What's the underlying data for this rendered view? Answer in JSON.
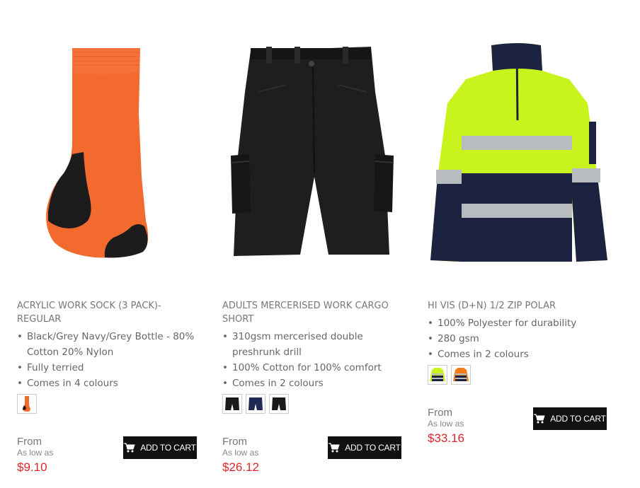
{
  "products": [
    {
      "title": "ACRYLIC WORK SOCK (3 PACK)- REGULAR",
      "features": [
        "Black/Grey Navy/Grey Bottle - 80% Cotton 20% Nylon",
        "Fully terried",
        "Comes in 4 colours"
      ],
      "from_label": "From",
      "as_low_as_label": "As low as",
      "price": "$9.10",
      "cart_label": "ADD TO CART",
      "image_icon": "sock-icon",
      "swatch_colors": [
        "#f26a2e"
      ]
    },
    {
      "title": "ADULTS MERCERISED WORK CARGO SHORT",
      "features": [
        "310gsm mercerised double preshrunk drill",
        "100% Cotton for 100% comfort",
        "Comes in 2 colours"
      ],
      "from_label": "From",
      "as_low_as_label": "As low as",
      "price": "$26.12",
      "cart_label": "ADD TO CART",
      "image_icon": "cargo-shorts-icon",
      "swatch_colors": [
        "#1a1a1a",
        "#1f2a55",
        "#1a1a1a"
      ]
    },
    {
      "title": "HI VIS (D+N) 1/2 ZIP POLAR",
      "features": [
        "100% Polyester for durability",
        "280 gsm",
        "Comes in 2 colours"
      ],
      "from_label": "From",
      "as_low_as_label": "As low as",
      "price": "$33.16",
      "cart_label": "ADD TO CART",
      "image_icon": "hi-vis-jacket-icon",
      "swatch_colors": [
        "#c8f31d",
        "#f07d1a"
      ]
    }
  ],
  "colors": {
    "price": "#d9262c",
    "button": "#111111",
    "text": "#666666"
  }
}
